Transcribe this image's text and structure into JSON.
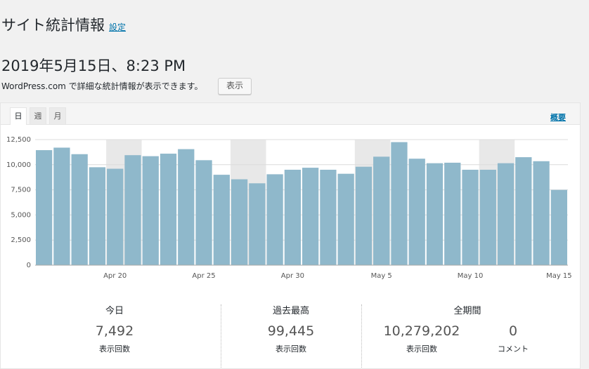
{
  "header": {
    "title": "サイト統計情報",
    "settings_link": "設定",
    "datetime": "2019年5月15日、8:23 PM",
    "wpcom_text": "WordPress.com で詳細な統計情報が表示できます。",
    "show_button": "表示"
  },
  "tabs": [
    {
      "label": "日",
      "active": true
    },
    {
      "label": "週",
      "active": false
    },
    {
      "label": "月",
      "active": false
    }
  ],
  "summary_link": "概要",
  "colors": {
    "bar": "#8fb8cb",
    "weekend_bg": "#e8e8e8",
    "link": "#0073aa"
  },
  "chart_data": {
    "type": "bar",
    "x": [
      "Apr 16",
      "Apr 17",
      "Apr 18",
      "Apr 19",
      "Apr 20",
      "Apr 21",
      "Apr 22",
      "Apr 23",
      "Apr 24",
      "Apr 25",
      "Apr 26",
      "Apr 27",
      "Apr 28",
      "Apr 29",
      "Apr 30",
      "May 1",
      "May 2",
      "May 3",
      "May 4",
      "May 5",
      "May 6",
      "May 7",
      "May 8",
      "May 9",
      "May 10",
      "May 11",
      "May 12",
      "May 13",
      "May 14",
      "May 15"
    ],
    "values": [
      11450,
      11700,
      11050,
      9750,
      9600,
      10950,
      10850,
      11100,
      11550,
      10450,
      9000,
      8550,
      8150,
      9050,
      9500,
      9700,
      9500,
      9100,
      9800,
      10800,
      12250,
      10600,
      10150,
      10200,
      9500,
      9500,
      10150,
      10750,
      10350,
      7492
    ],
    "highlight_ranges": [
      [
        4,
        5
      ],
      [
        11,
        12
      ],
      [
        18,
        19
      ],
      [
        25,
        26
      ]
    ],
    "ylim": [
      0,
      12500
    ],
    "yticks": [
      "0",
      "2,500",
      "5,000",
      "7,500",
      "10,000",
      "12,500"
    ],
    "ytick_values": [
      0,
      2500,
      5000,
      7500,
      10000,
      12500
    ],
    "xtick_labels": [
      {
        "index": 4,
        "label": "Apr 20"
      },
      {
        "index": 9,
        "label": "Apr 25"
      },
      {
        "index": 14,
        "label": "Apr 30"
      },
      {
        "index": 19,
        "label": "May 5"
      },
      {
        "index": 24,
        "label": "May 10"
      },
      {
        "index": 29,
        "label": "May 15"
      }
    ],
    "grid": true
  },
  "stats": {
    "today": {
      "label": "今日",
      "value": "7,492",
      "sub": "表示回数"
    },
    "best": {
      "label": "過去最高",
      "value": "99,445",
      "sub": "表示回数"
    },
    "all_time": {
      "label": "全期間",
      "views_value": "10,279,202",
      "views_sub": "表示回数",
      "comments_value": "0",
      "comments_sub": "コメント"
    }
  }
}
